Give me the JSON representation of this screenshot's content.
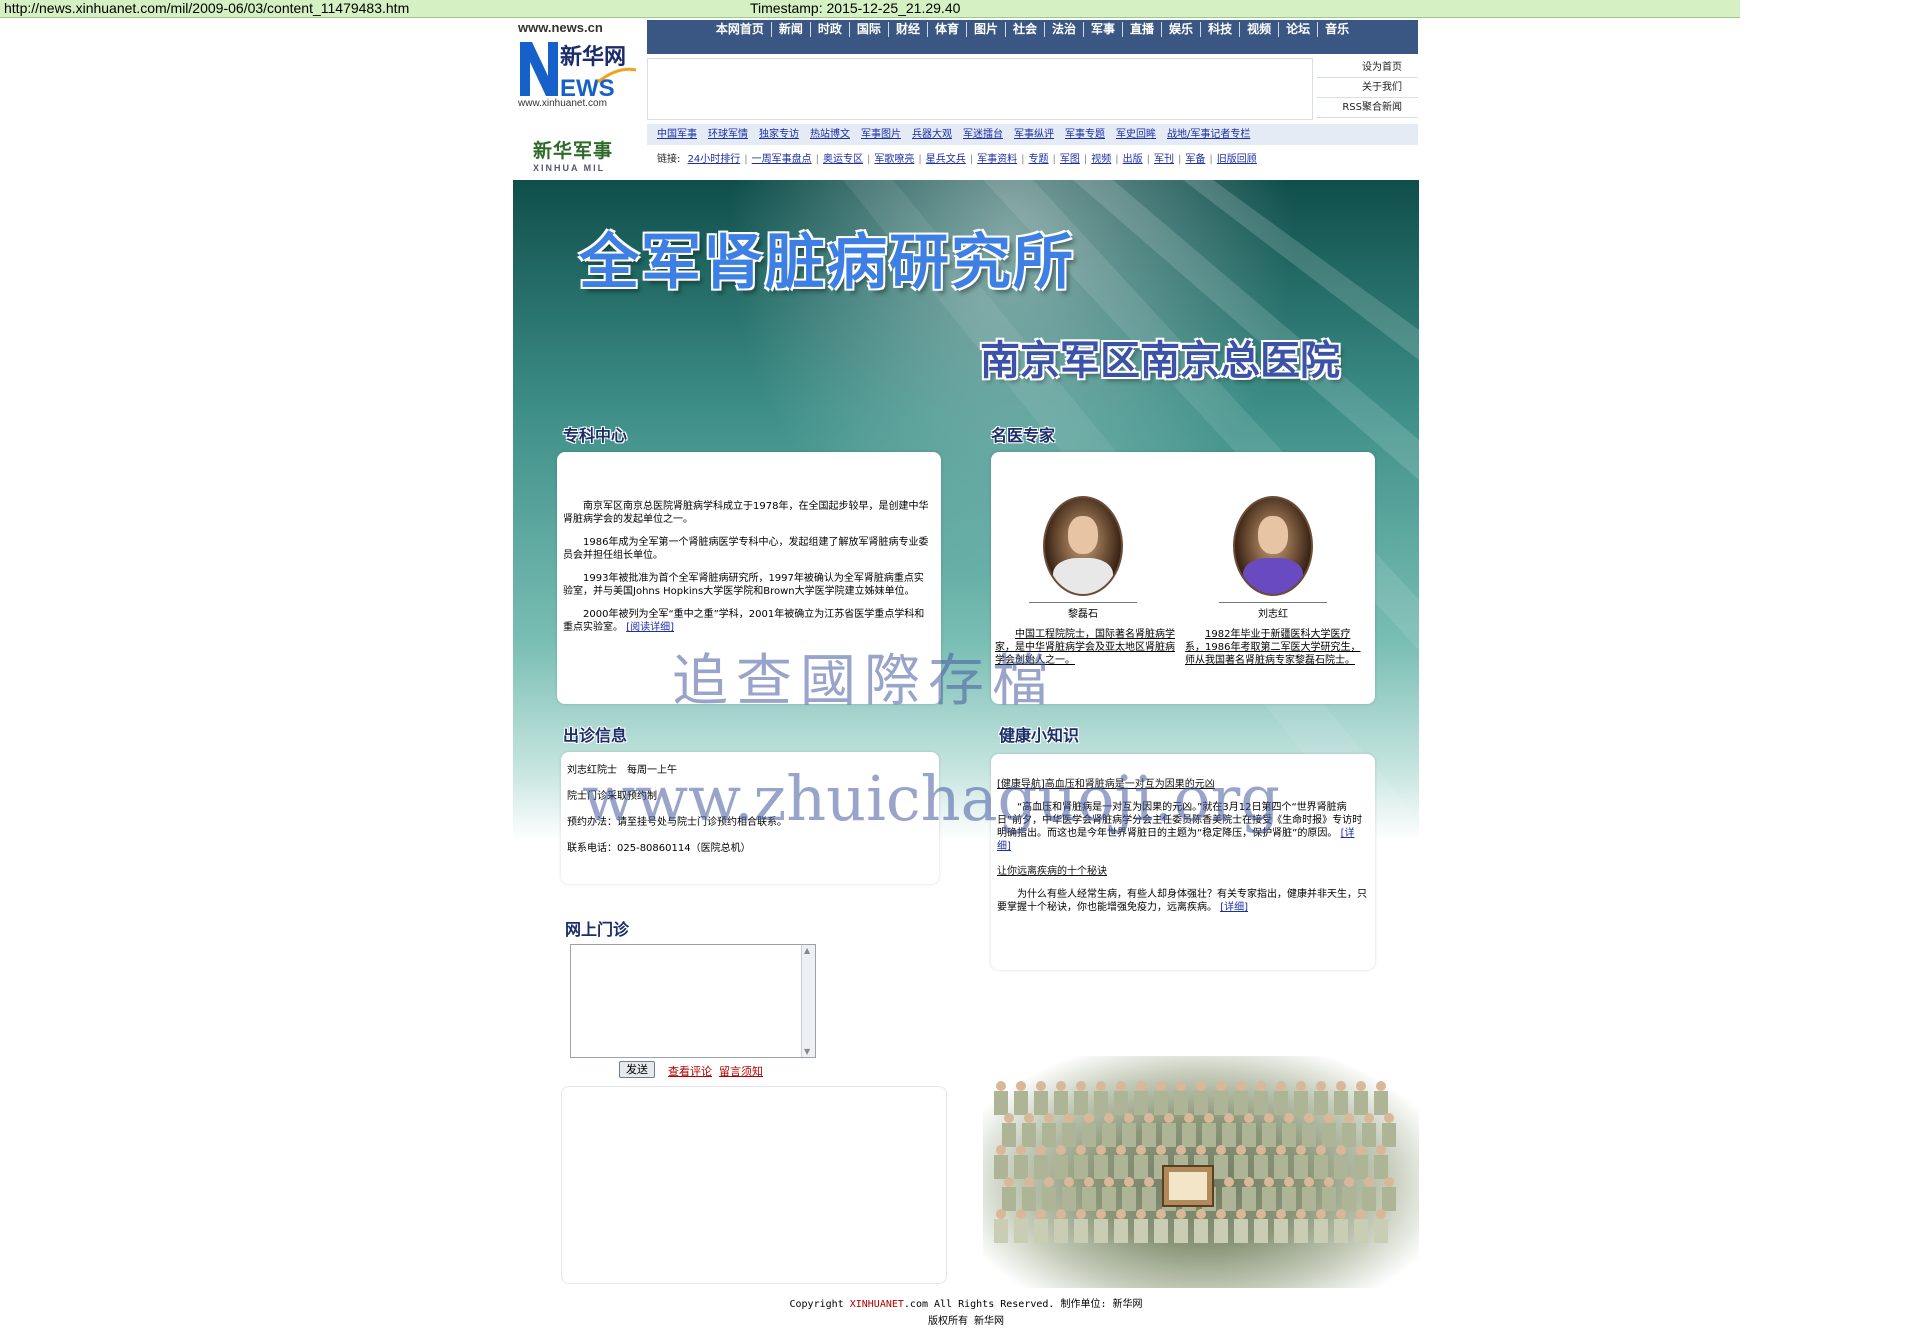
{
  "browser": {
    "url": "http://news.xinhuanet.com/mil/2009-06/03/content_11479483.htm",
    "timestamp": "Timestamp: 2015-12-25_21.29.40"
  },
  "header": {
    "site_name": "www.news.cn",
    "domain": "www.xinhuanet.com",
    "logo_icon": "xinhua-news-logo-icon",
    "nav": [
      "本网首页",
      "新闻",
      "时政",
      "国际",
      "财经",
      "体育",
      "图片",
      "社会",
      "法治",
      "军事",
      "直播",
      "娱乐",
      "科技",
      "视频",
      "论坛",
      "音乐"
    ],
    "side_links": [
      "设为首页",
      "关于我们",
      "RSS聚合新闻"
    ]
  },
  "channel": {
    "logo_cn": "新华军事",
    "logo_en": "XINHUA MIL",
    "subnav": [
      "中国军事",
      "环球军情",
      "独家专访",
      "热站博文",
      "军事图片",
      "兵器大观",
      "军迷擂台",
      "军事纵评",
      "军事专题",
      "军史回眸",
      "战地/军事记者专栏"
    ],
    "links_label": "链接:",
    "links": [
      "24小时排行",
      "一周军事盘点",
      "奥运专区",
      "军歌嘹亮",
      "星兵文兵",
      "军事资料",
      "专题",
      "军图",
      "视频",
      "出版",
      "军刊",
      "军备",
      "旧版回顾"
    ]
  },
  "banner": {
    "title": "全军肾脏病研究所",
    "subtitle": "南京军区南京总医院"
  },
  "specialty": {
    "heading": "专科中心",
    "paragraphs": [
      "南京军区南京总医院肾脏病学科成立于1978年，在全国起步较早，是创建中华肾脏病学会的发起单位之一。",
      "1986年成为全军第一个肾脏病医学专科中心，发起组建了解放军肾脏病专业委员会并担任组长单位。",
      "1993年被批准为首个全军肾脏病研究所，1997年被确认为全军肾脏病重点实验室，并与美国Johns Hopkins大学医学院和Brown大学医学院建立姊妹单位。",
      "2000年被列为全军“重中之重”学科，2001年被确立为江苏省医学重点学科和重点实验室。"
    ],
    "more": "[阅读详细]"
  },
  "experts": {
    "heading": "名医专家",
    "items": [
      {
        "name": "黎磊石",
        "desc": "中国工程院院士，国际著名肾脏病学家，是中华肾脏病学会及亚太地区肾脏病学会创始人之一。"
      },
      {
        "name": "刘志红",
        "desc": "1982年毕业于新疆医科大学医疗系，1986年考取第二军医大学研究生，师从我国著名肾脏病专家黎磊石院士。"
      }
    ]
  },
  "clinic": {
    "heading": "出诊信息",
    "lines": [
      "刘志红院士　每周一上午",
      "院士门诊采取预约制",
      "预约办法：请至挂号处与院士门诊预约相合联系。",
      "联系电话：025-80860114（医院总机）"
    ]
  },
  "health": {
    "heading": "健康小知识",
    "items": [
      {
        "title": "[健康导航]高血压和肾脏病是一对互为因果的元凶",
        "text": "“高血压和肾脏病是一对互为因果的元凶。”就在3月12日第四个“世界肾脏病日”前夕，中华医学会肾脏病学分会主任委员陈香美院士在接受《生命时报》专访时明确指出。而这也是今年世界肾脏日的主题为“稳定降压，保护肾脏”的原因。",
        "more": "[详细]"
      },
      {
        "title": "让你远离疾病的十个秘诀",
        "text": "为什么有些人经常生病，有些人却身体强壮？有关专家指出，健康并非天生，只要掌握十个秘诀，你也能增强免疫力，远离疾病。",
        "more": "[详细]"
      }
    ]
  },
  "online": {
    "heading": "网上门诊",
    "textarea_value": "",
    "send": "发送",
    "view_comments": "查看评论",
    "notice": "留言须知"
  },
  "footer": {
    "copyright_prefix": "Copyright ",
    "brand": "XINHUANET",
    "copyright_suffix": ".com  All Rights Reserved.    制作单位: 新华网",
    "rights": "版权所有 新华网"
  },
  "watermark": {
    "line1": "追查國際存檔",
    "line2": "www.zhuichaguoji.org"
  },
  "colors": {
    "nav_bg": "#3a5784",
    "link": "#1d2fa6",
    "accent_red": "#b00000",
    "topbar_bg": "#d5f0c2"
  }
}
